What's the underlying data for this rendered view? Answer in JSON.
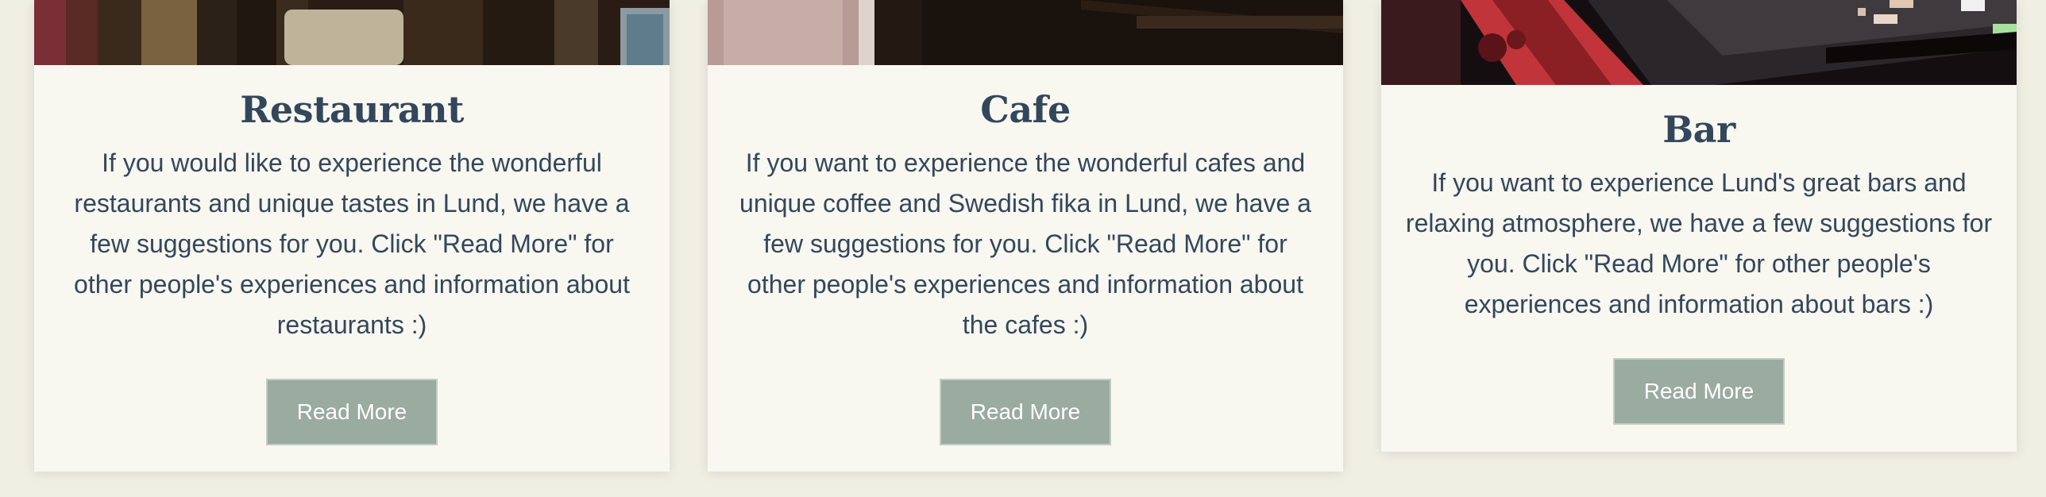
{
  "cards": [
    {
      "title": "Restaurant",
      "description": "If you would like to experience the wonderful restaurants and unique tastes in Lund, we have a few suggestions for you. Click \"Read More\" for other people's experiences and information about restaurants :)",
      "button_label": "Read More"
    },
    {
      "title": "Cafe",
      "description": "If you want to experience the wonderful cafes and unique coffee and Swedish fika in Lund, we have a few suggestions for you. Click \"Read More\" for other people's experiences and information about the cafes :)",
      "button_label": "Read More"
    },
    {
      "title": "Bar",
      "description": "If you want to experience Lund's great bars and relaxing atmosphere, we have a few suggestions for you. Click \"Read More\" for other people's experiences and information about bars :)",
      "button_label": "Read More"
    }
  ],
  "colors": {
    "page_background": "#f0efe4",
    "card_background": "#f8f7f0",
    "text": "#33475b",
    "button": "#9aaba0"
  }
}
